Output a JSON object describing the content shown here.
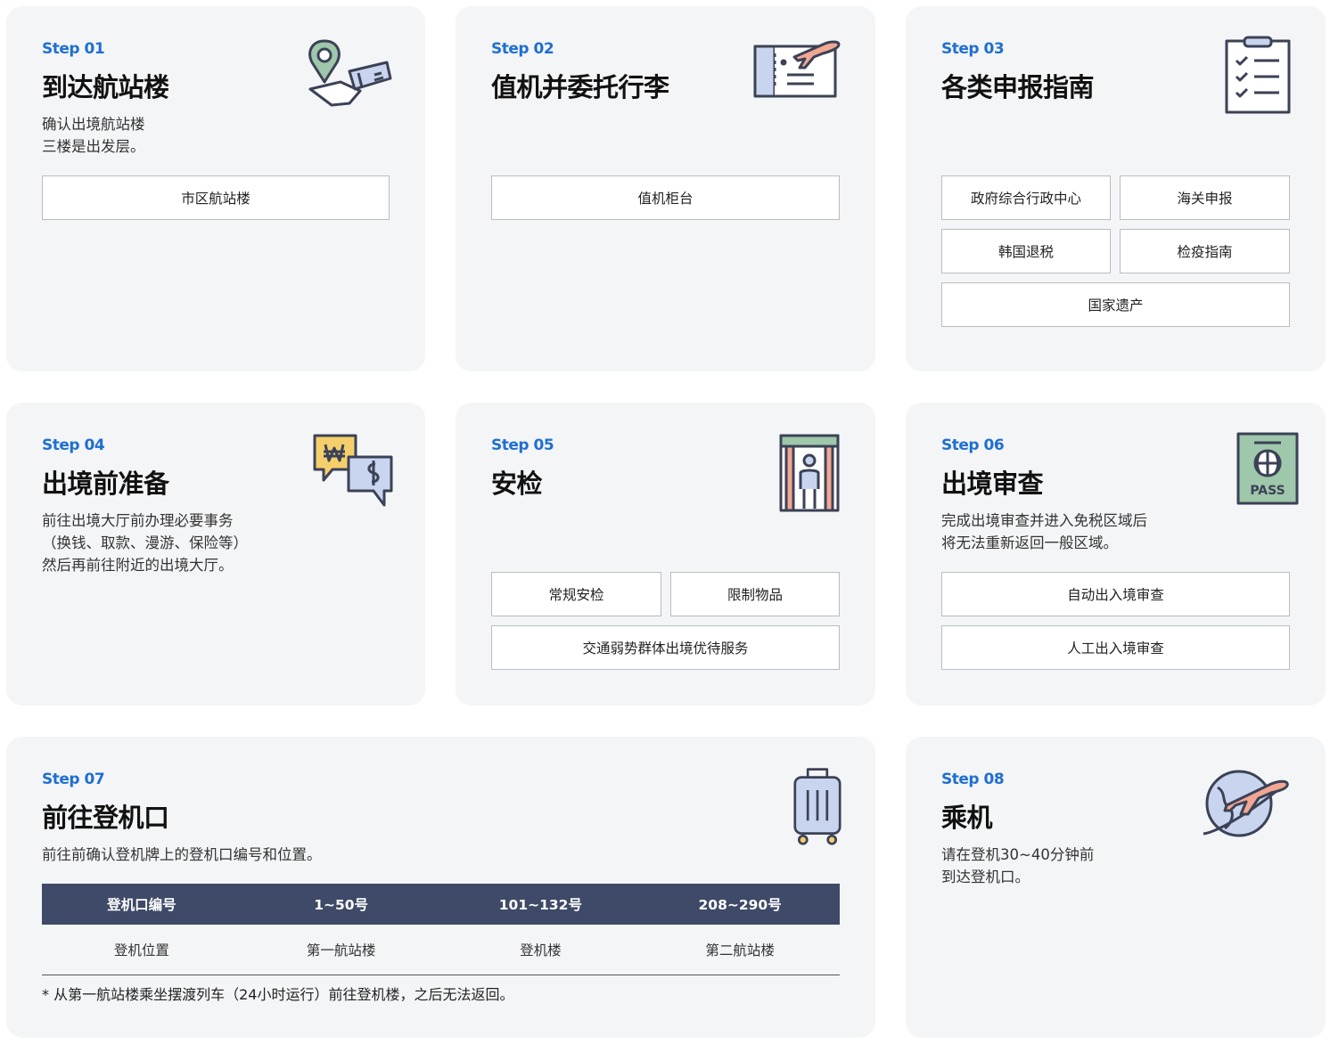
{
  "steps": [
    {
      "label": "Step 01",
      "title": "到达航站楼",
      "desc": "确认出境航站楼\n三楼是出发层。",
      "buttons": [
        "市区航站楼"
      ],
      "icon": "map-pin-ticket-icon"
    },
    {
      "label": "Step 02",
      "title": "值机并委托行李",
      "desc": "",
      "buttons": [
        "值机柜台"
      ],
      "icon": "boarding-ticket-plane-icon"
    },
    {
      "label": "Step 03",
      "title": "各类申报指南",
      "desc": "",
      "buttons": [
        "政府综合行政中心",
        "海关申报",
        "韩国退税",
        "检疫指南",
        "国家遗产"
      ],
      "icon": "checklist-clipboard-icon"
    },
    {
      "label": "Step 04",
      "title": "出境前准备",
      "desc": "前往出境大厅前办理必要事务\n（换钱、取款、漫游、保险等）\n然后再前往附近的出境大厅。",
      "buttons": [],
      "icon": "currency-exchange-icon"
    },
    {
      "label": "Step 05",
      "title": "安检",
      "desc": "",
      "buttons": [
        "常规安检",
        "限制物品",
        "交通弱势群体出境优待服务"
      ],
      "icon": "security-gate-icon"
    },
    {
      "label": "Step 06",
      "title": "出境审查",
      "desc": "完成出境审查并进入免税区域后\n将无法重新返回一般区域。",
      "buttons": [
        "自动出入境审查",
        "人工出入境审查"
      ],
      "icon": "passport-icon"
    },
    {
      "label": "Step 07",
      "title": "前往登机口",
      "desc": "前往前确认登机牌上的登机口编号和位置。",
      "buttons": [],
      "icon": "suitcase-icon"
    },
    {
      "label": "Step 08",
      "title": "乘机",
      "desc": "请在登机30~40分钟前\n到达登机口。",
      "buttons": [],
      "icon": "globe-plane-icon"
    }
  ],
  "gate_table": {
    "headers": [
      "登机口编号",
      "1~50号",
      "101~132号",
      "208~290号"
    ],
    "row": [
      "登机位置",
      "第一航站楼",
      "登机楼",
      "第二航站楼"
    ],
    "note": "* 从第一航站楼乘坐摆渡列车（24小时运行）前往登机楼，之后无法返回。"
  },
  "colors": {
    "accent": "#1f6fd1",
    "card_bg": "#f4f5f7",
    "table_header": "#3e4a67",
    "icon_stroke": "#3b4256"
  }
}
